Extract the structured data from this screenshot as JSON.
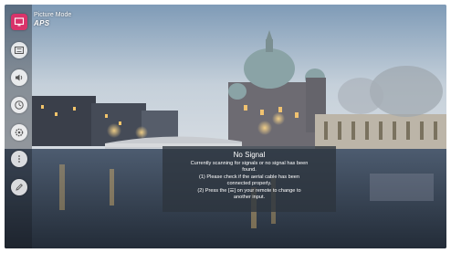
{
  "picture_mode": {
    "title": "Picture Mode",
    "value": "APS"
  },
  "side_menu": {
    "items": [
      {
        "icon": "picture-mode-icon"
      },
      {
        "icon": "aspect-ratio-icon"
      },
      {
        "icon": "sound-icon"
      },
      {
        "icon": "timer-icon"
      },
      {
        "icon": "settings-icon"
      },
      {
        "icon": "more-icon"
      },
      {
        "icon": "edit-icon"
      }
    ],
    "accent_color": "#d9336a"
  },
  "no_signal": {
    "title": "No Signal",
    "lines": [
      "Currently scanning for signals or no signal has been",
      "found.",
      "(1) Please check if the aerial cable has been",
      "connected properly.",
      "(2) Press the [☰] on your remote to change to",
      "another input."
    ]
  }
}
